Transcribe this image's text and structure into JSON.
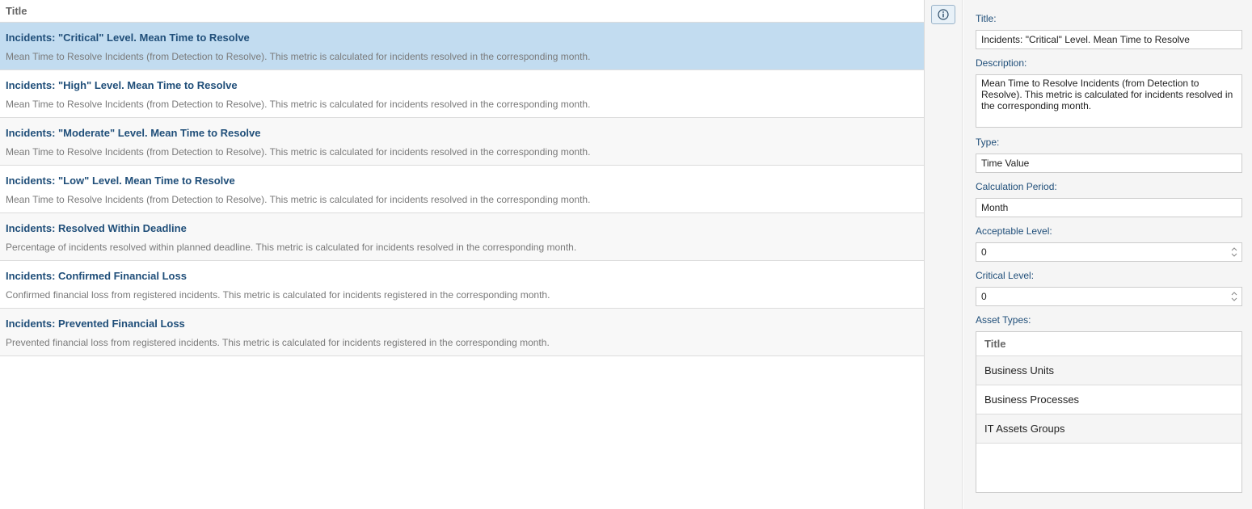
{
  "list": {
    "header": "Title",
    "rows": [
      {
        "title": "Incidents: \"Critical\" Level. Mean Time to Resolve",
        "description": "Mean Time to Resolve Incidents (from Detection to Resolve). This metric is calculated for incidents resolved in the corresponding month."
      },
      {
        "title": "Incidents: \"High\" Level. Mean Time to Resolve",
        "description": "Mean Time to Resolve Incidents (from Detection to Resolve). This metric is calculated for incidents resolved in the corresponding month."
      },
      {
        "title": "Incidents: \"Moderate\" Level. Mean Time to Resolve",
        "description": "Mean Time to Resolve Incidents (from Detection to Resolve). This metric is calculated for incidents resolved in the corresponding month."
      },
      {
        "title": "Incidents: \"Low\" Level. Mean Time to Resolve",
        "description": "Mean Time to Resolve Incidents (from Detection to Resolve). This metric is calculated for incidents resolved in the corresponding month."
      },
      {
        "title": "Incidents: Resolved Within Deadline",
        "description": "Percentage of incidents resolved within planned deadline. This metric is calculated for incidents resolved in the corresponding month."
      },
      {
        "title": "Incidents: Confirmed Financial Loss",
        "description": "Confirmed financial loss from registered incidents. This metric is calculated for incidents registered in the corresponding month."
      },
      {
        "title": "Incidents: Prevented Financial Loss",
        "description": "Prevented financial loss from registered incidents. This metric is calculated for incidents registered in the corresponding month."
      }
    ]
  },
  "toolbar": {
    "info_icon": "info-icon"
  },
  "details": {
    "title_label": "Title:",
    "title_value": "Incidents: \"Critical\" Level. Mean Time to Resolve",
    "description_label": "Description:",
    "description_value": "Mean Time to Resolve Incidents (from Detection to Resolve). This metric is calculated for incidents resolved in the corresponding month.",
    "type_label": "Type:",
    "type_value": "Time Value",
    "period_label": "Calculation Period:",
    "period_value": "Month",
    "acceptable_label": "Acceptable Level:",
    "acceptable_value": "0",
    "critical_label": "Critical Level:",
    "critical_value": "0",
    "asset_types_label": "Asset Types:",
    "asset_types": {
      "header": "Title",
      "rows": [
        "Business Units",
        "Business Processes",
        "IT Assets Groups"
      ]
    }
  },
  "colors": {
    "selected_row": "#c2dcf0",
    "title_text": "#1f4e79",
    "panel_bg": "#f5f5f5"
  }
}
